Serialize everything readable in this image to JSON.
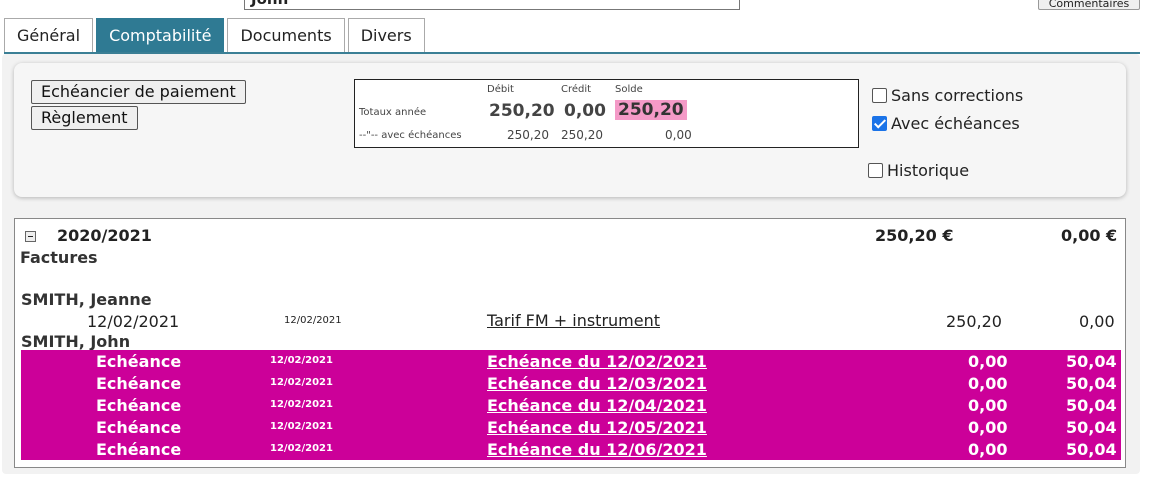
{
  "top": {
    "name_value": "John",
    "comments_button": "Commentaires"
  },
  "tabs": [
    "Général",
    "Comptabilité",
    "Documents",
    "Divers"
  ],
  "active_tab": "Comptabilité",
  "toolbar": {
    "schedule_button": "Echéancier de paiement",
    "payment_button": "Règlement",
    "totals": {
      "headers": {
        "debit": "Débit",
        "credit": "Crédit",
        "balance": "Solde"
      },
      "year_label": "Totaux année",
      "year_debit": "250,20",
      "year_credit": "0,00",
      "year_balance": "250,20",
      "sched_label": "--\"-- avec échéances",
      "sched_debit": "250,20",
      "sched_credit": "250,20",
      "sched_balance": "0,00"
    },
    "checkboxes": {
      "no_corrections": {
        "label": "Sans corrections",
        "checked": false
      },
      "with_schedules": {
        "label": "Avec échéances",
        "checked": true
      },
      "history": {
        "label": "Historique",
        "checked": false
      }
    }
  },
  "ledger": {
    "year": "2020/2021",
    "year_debit": "250,20 €",
    "year_credit": "0,00 €",
    "section": "Factures",
    "person1": "SMITH, Jeanne",
    "invoice": {
      "date": "12/02/2021",
      "doc_date": "12/02/2021",
      "description": "Tarif FM + instrument",
      "debit": "250,20",
      "credit": "0,00"
    },
    "person2": "SMITH, John",
    "schedule_rows": [
      {
        "label": "Echéance",
        "doc_date": "12/02/2021",
        "description": "Echéance du 12/02/2021",
        "debit": "0,00",
        "credit": "50,04"
      },
      {
        "label": "Echéance",
        "doc_date": "12/02/2021",
        "description": "Echéance du 12/03/2021",
        "debit": "0,00",
        "credit": "50,04"
      },
      {
        "label": "Echéance",
        "doc_date": "12/02/2021",
        "description": "Echéance du 12/04/2021",
        "debit": "0,00",
        "credit": "50,04"
      },
      {
        "label": "Echéance",
        "doc_date": "12/02/2021",
        "description": "Echéance du 12/05/2021",
        "debit": "0,00",
        "credit": "50,04"
      },
      {
        "label": "Echéance",
        "doc_date": "12/02/2021",
        "description": "Echéance du 12/06/2021",
        "debit": "0,00",
        "credit": "50,04"
      }
    ]
  },
  "colors": {
    "active_tab": "#2f7a93",
    "schedule_highlight": "#cc0099",
    "balance_highlight": "#f49ac7"
  }
}
